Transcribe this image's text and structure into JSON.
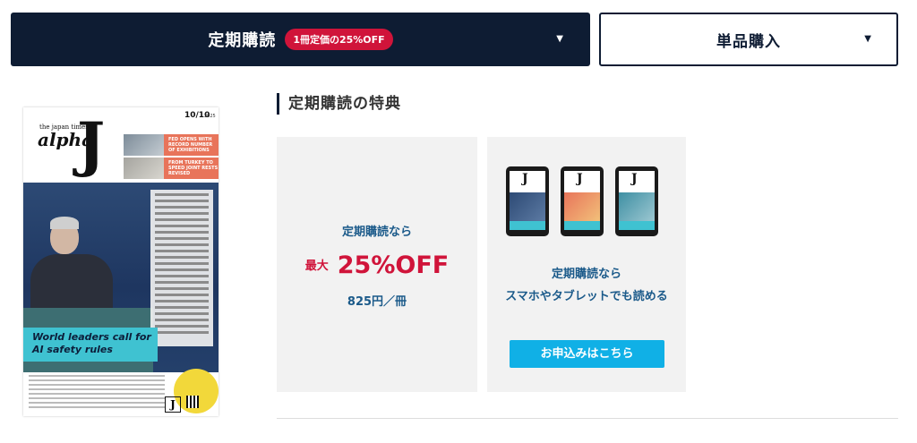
{
  "tabs": {
    "subscription": {
      "label": "定期購読",
      "badge": "1冊定価の25%OFF",
      "caret": "▼"
    },
    "single": {
      "label": "単品購入",
      "caret": "▼"
    }
  },
  "cover": {
    "brand_small": "the japan times",
    "brand_alpha": "alpha",
    "brand_j": "J",
    "issue_date": "10/10",
    "issue_year": "2025",
    "promo1": "FED OPENS WITH RECORD NUMBER OF EXHIBITIONS",
    "promo2": "FROM TURKEY TO SPEED JOINT RESTS REVISED",
    "headline": "World leaders call for AI safety rules"
  },
  "benefits": {
    "title": "定期購読の特典",
    "card1": {
      "intro": "定期購読なら",
      "prefix": "最大",
      "discount": "25%OFF",
      "price": "825円／冊"
    },
    "card2": {
      "line1": "定期購読なら",
      "line2": "スマホやタブレットでも読める",
      "button": "お申込みはこちら"
    }
  },
  "colors": {
    "navy": "#0e1c33",
    "accent_red": "#d0143a",
    "text_blue": "#1b5a8a",
    "button_blue": "#10b0e6",
    "card_bg": "#f2f2f2"
  }
}
